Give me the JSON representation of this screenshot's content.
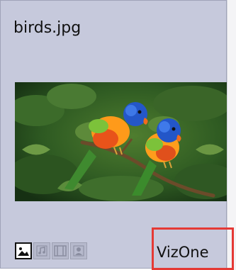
{
  "asset": {
    "filename": "birds.jpg",
    "source": "VizOne",
    "thumbnail_alt": "Two colorful lorikeets perched on a branch"
  },
  "media_types": [
    {
      "name": "image",
      "icon": "image-icon",
      "active": true
    },
    {
      "name": "audio",
      "icon": "music-note-icon",
      "active": false
    },
    {
      "name": "video",
      "icon": "film-icon",
      "active": false
    },
    {
      "name": "person",
      "icon": "person-icon",
      "active": false
    }
  ],
  "colors": {
    "card_bg": "#c6c9dc",
    "highlight": "#e53935"
  }
}
